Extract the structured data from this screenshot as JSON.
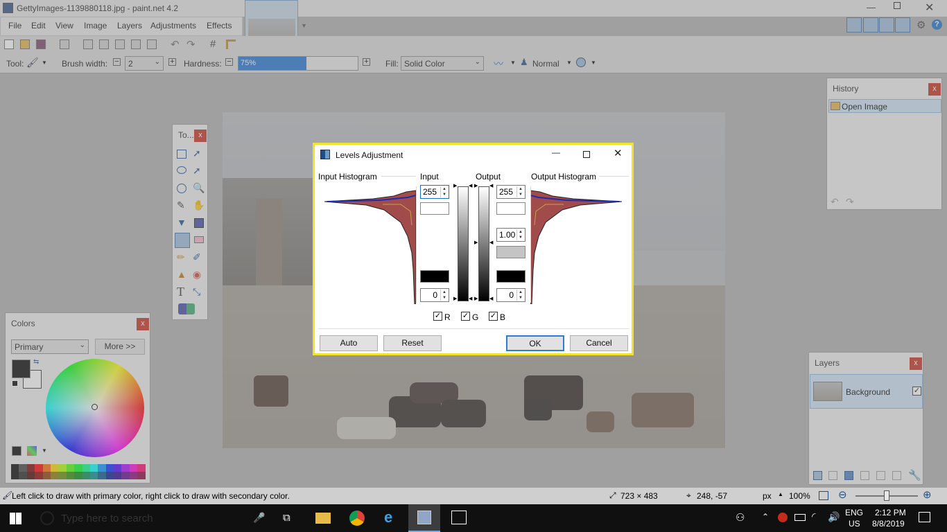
{
  "window": {
    "title": "GettyImages-1139880118.jpg - paint.net 4.2"
  },
  "menu": [
    "File",
    "Edit",
    "View",
    "Image",
    "Layers",
    "Adjustments",
    "Effects"
  ],
  "options": {
    "tool_label": "Tool:",
    "brush_width_label": "Brush width:",
    "brush_width_value": "2",
    "hardness_label": "Hardness:",
    "hardness_value": "75%",
    "hardness_fraction": 0.75,
    "fill_label": "Fill:",
    "fill_value": "Solid Color",
    "blend_mode": "Normal"
  },
  "tools_panel": {
    "title": "To..."
  },
  "colors_panel": {
    "title": "Colors",
    "mode": "Primary",
    "more_button": "More >>",
    "palette": [
      "#000000",
      "#404040",
      "#7f0000",
      "#ff0000",
      "#ff6a00",
      "#ffd800",
      "#b6ff00",
      "#4cff00",
      "#00ff21",
      "#00ff90",
      "#00ffff",
      "#0094ff",
      "#0026ff",
      "#4800ff",
      "#b200ff",
      "#ff00dc",
      "#ff006e"
    ]
  },
  "history_panel": {
    "title": "History",
    "items": [
      "Open Image"
    ]
  },
  "layers_panel": {
    "title": "Layers",
    "layers": [
      "Background"
    ]
  },
  "dialog": {
    "title": "Levels Adjustment",
    "input_histogram": "Input Histogram",
    "input": "Input",
    "output": "Output",
    "output_histogram": "Output Histogram",
    "input_high": "255",
    "input_low": "0",
    "output_high": "255",
    "output_gamma": "1.00",
    "output_low": "0",
    "channels": [
      "R",
      "G",
      "B"
    ],
    "buttons": {
      "auto": "Auto",
      "reset": "Reset",
      "ok": "OK",
      "cancel": "Cancel"
    }
  },
  "status": {
    "hint": "Left click to draw with primary color, right click to draw with secondary color.",
    "image_size": "723 × 483",
    "cursor_pos": "248, -57",
    "unit": "px",
    "zoom": "100%",
    "zoom_fraction": 0.5
  },
  "taskbar": {
    "search_placeholder": "Type here to search",
    "lang": "ENG",
    "region": "US",
    "time": "2:12 PM",
    "date": "8/8/2019"
  }
}
